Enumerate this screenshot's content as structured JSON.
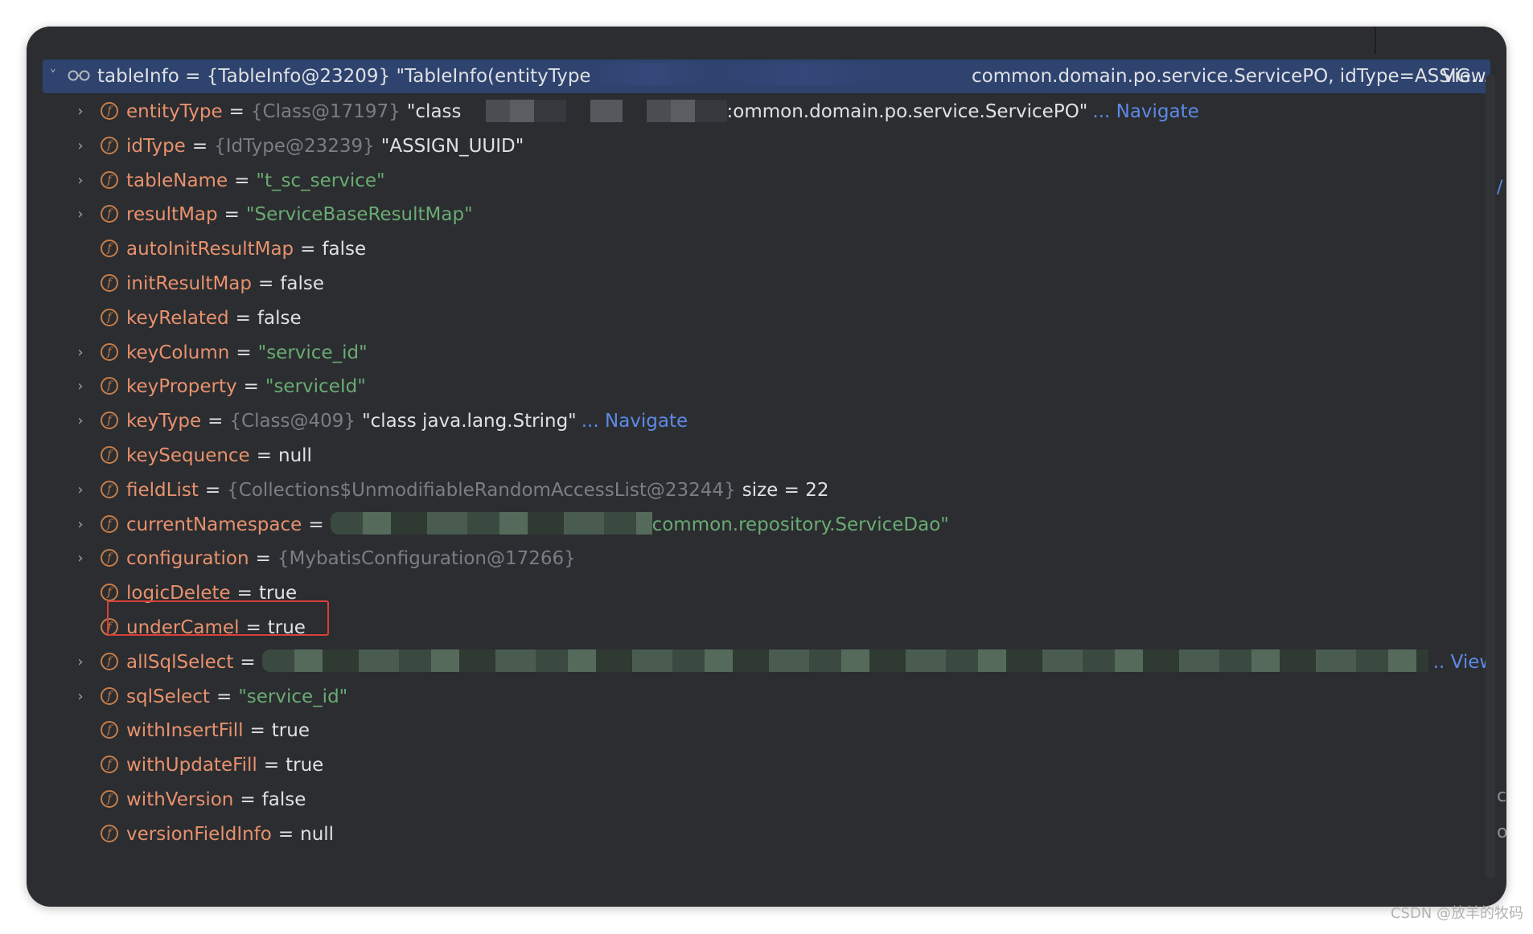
{
  "root": {
    "name": "tableInfo",
    "text_before": " = {TableInfo@23209} \"TableInfo(entityType=clas",
    "text_after": "common.domain.po.service.ServicePO, idType=ASSIG…",
    "view_label": "View"
  },
  "fields": [
    {
      "name": "entityType",
      "ref": "{Class@17197}",
      "value": "\"class",
      "tail": ":ommon.domain.po.service.ServicePO\"",
      "nav": "... Navigate",
      "expandable": true,
      "kind": "val"
    },
    {
      "name": "idType",
      "ref": "{IdType@23239}",
      "value": "\"ASSIGN_UUID\"",
      "expandable": true,
      "kind": "val"
    },
    {
      "name": "tableName",
      "value": "\"t_sc_service\"",
      "expandable": true,
      "kind": "str"
    },
    {
      "name": "resultMap",
      "value": "\"ServiceBaseResultMap\"",
      "expandable": true,
      "kind": "str"
    },
    {
      "name": "autoInitResultMap",
      "value": "false",
      "expandable": false,
      "kind": "val"
    },
    {
      "name": "initResultMap",
      "value": "false",
      "expandable": false,
      "kind": "val"
    },
    {
      "name": "keyRelated",
      "value": "false",
      "expandable": false,
      "kind": "val"
    },
    {
      "name": "keyColumn",
      "value": "\"service_id\"",
      "expandable": true,
      "kind": "str"
    },
    {
      "name": "keyProperty",
      "value": "\"serviceId\"",
      "expandable": true,
      "kind": "str"
    },
    {
      "name": "keyType",
      "ref": "{Class@409}",
      "value": "\"class java.lang.String\"",
      "nav": "... Navigate",
      "expandable": true,
      "kind": "val"
    },
    {
      "name": "keySequence",
      "value": "null",
      "expandable": false,
      "kind": "val"
    },
    {
      "name": "fieldList",
      "ref": "{Collections$UnmodifiableRandomAccessList@23244}",
      "value": "size = 22",
      "expandable": true,
      "kind": "val"
    },
    {
      "name": "currentNamespace",
      "tail": "common.repository.ServiceDao\"",
      "expandable": true,
      "kind": "str"
    },
    {
      "name": "configuration",
      "ref": "{MybatisConfiguration@17266}",
      "expandable": true,
      "kind": "val"
    },
    {
      "name": "logicDelete",
      "value": "true",
      "expandable": false,
      "kind": "val",
      "highlighted": true
    },
    {
      "name": "underCamel",
      "value": "true",
      "expandable": false,
      "kind": "val"
    },
    {
      "name": "allSqlSelect",
      "nav": ".. View",
      "expandable": true,
      "kind": "str"
    },
    {
      "name": "sqlSelect",
      "value": "\"service_id\"",
      "expandable": true,
      "kind": "str"
    },
    {
      "name": "withInsertFill",
      "value": "true",
      "expandable": false,
      "kind": "val"
    },
    {
      "name": "withUpdateFill",
      "value": "true",
      "expandable": false,
      "kind": "val"
    },
    {
      "name": "withVersion",
      "value": "false",
      "expandable": false,
      "kind": "val"
    },
    {
      "name": "versionFieldInfo",
      "value": "null",
      "expandable": false,
      "kind": "val"
    }
  ],
  "field_icon_glyph": "f",
  "chevron_right_glyph": "›",
  "chevron_down_glyph": "˅",
  "equals": "=",
  "watermark": "CSDN @放羊的牧码",
  "colors": {
    "background": "#2b2d30",
    "selection": "#2e436e",
    "field_name": "#e8916e",
    "string": "#6aab73",
    "reference": "#7a7e85",
    "link": "#5c8ae6",
    "highlight_border": "#d9403a"
  }
}
